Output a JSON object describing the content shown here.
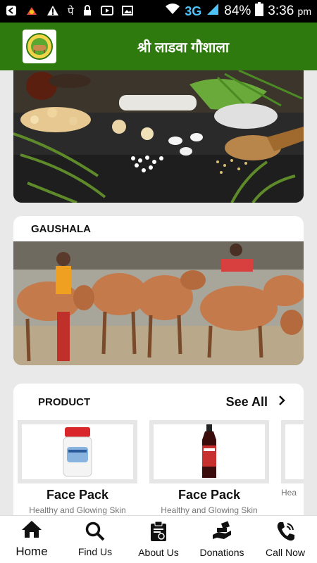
{
  "status": {
    "battery": "84%",
    "time": "3:36",
    "ampm": "pm",
    "network": "3G"
  },
  "header": {
    "title": "श्री लाडवा गौशाला"
  },
  "gaushala": {
    "label": "GAUSHALA"
  },
  "product": {
    "label": "PRODUCT",
    "see_all": "See All",
    "items": [
      {
        "name": "Face Pack",
        "desc": "Healthy and Glowing Skin"
      },
      {
        "name": "Face Pack",
        "desc": "Healthy and Glowing Skin"
      },
      {
        "name": "",
        "desc": "Hea"
      }
    ]
  },
  "nav": {
    "items": [
      {
        "label": "Home",
        "icon": "home-icon"
      },
      {
        "label": "Find Us",
        "icon": "search-icon"
      },
      {
        "label": "About Us",
        "icon": "clipboard-icon"
      },
      {
        "label": "Donations",
        "icon": "donation-icon"
      },
      {
        "label": "Call Now",
        "icon": "phone-icon"
      }
    ]
  },
  "colors": {
    "brand": "#2f7a0f",
    "background": "#e9e9e9"
  }
}
